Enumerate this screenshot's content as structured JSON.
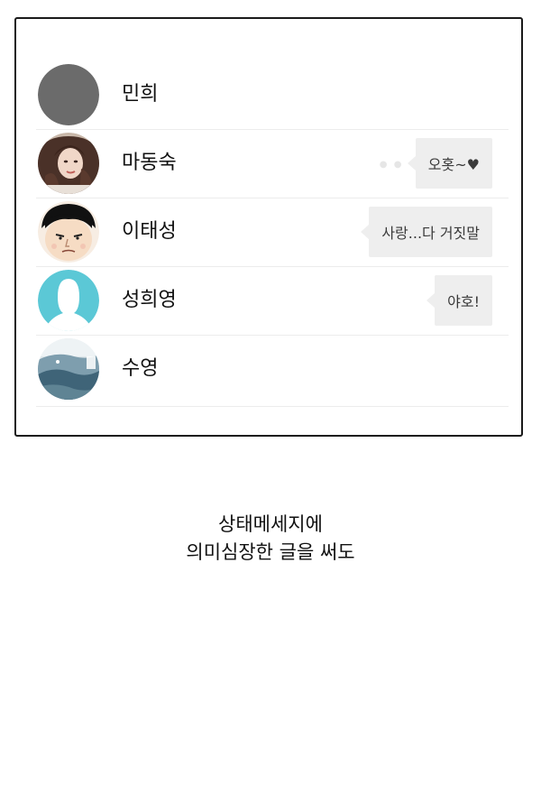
{
  "friends": [
    {
      "name": "민희",
      "status": "",
      "avatar": "gray-circle-avatar"
    },
    {
      "name": "마동숙",
      "status": "오홋~♥",
      "avatar": "woman-photo-avatar"
    },
    {
      "name": "이태성",
      "status": "사랑...다 거짓말",
      "avatar": "man-drawing-avatar"
    },
    {
      "name": "성희영",
      "status": "야호!",
      "avatar": "default-profile-avatar"
    },
    {
      "name": "수영",
      "status": "",
      "avatar": "landscape-photo-avatar"
    }
  ],
  "caption": {
    "line1": "상태메세지에",
    "line2": "의미심장한 글을 써도"
  },
  "colors": {
    "border": "#1a1a1a",
    "bubble": "#eeeeee",
    "divider": "#ececec",
    "default_avatar": "#5bc8d6"
  }
}
